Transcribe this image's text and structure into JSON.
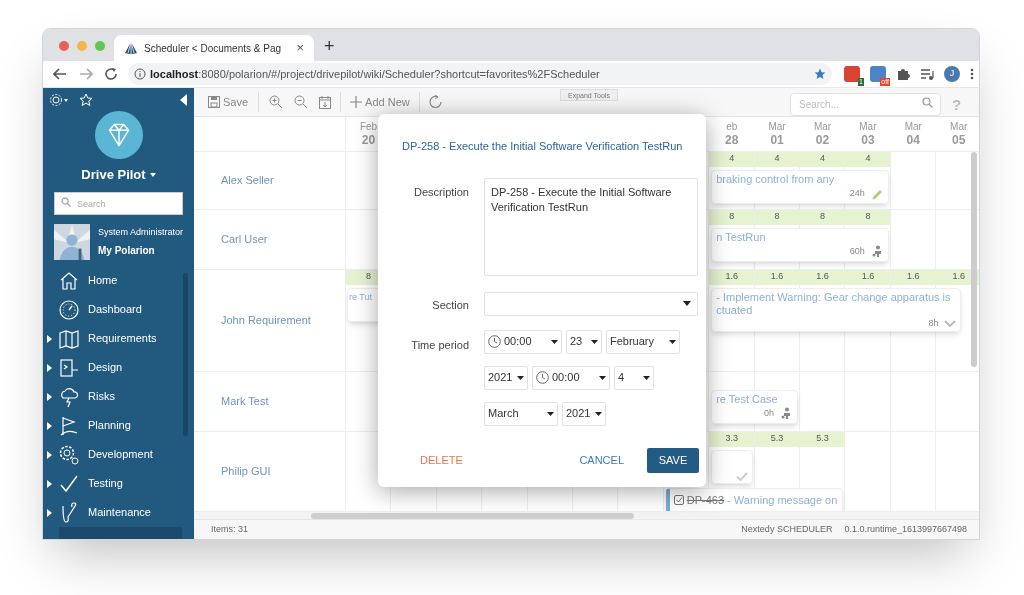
{
  "browser": {
    "tab": {
      "title": "Scheduler < Documents & Pag",
      "close": "×"
    },
    "new_tab": "+",
    "url": {
      "host": "localhost",
      "path": ":8080/polarion/#/project/drivepilot/wiki/Scheduler?shortcut=favorites%2FScheduler"
    },
    "extensions": [
      {
        "badge": "1",
        "color": "#d9432f"
      },
      {
        "badge": "off",
        "color": "#4a86c5"
      }
    ],
    "profile": "J"
  },
  "sidebar": {
    "project": "Drive Pilot",
    "search": {
      "placeholder": "Search"
    },
    "user": {
      "role": "System Administrator",
      "link": "My Polarion"
    },
    "items": [
      {
        "label": "Home",
        "expandable": false
      },
      {
        "label": "Dashboard",
        "expandable": false
      },
      {
        "label": "Requirements",
        "expandable": true
      },
      {
        "label": "Design",
        "expandable": true
      },
      {
        "label": "Risks",
        "expandable": true
      },
      {
        "label": "Planning",
        "expandable": true
      },
      {
        "label": "Development",
        "expandable": true
      },
      {
        "label": "Testing",
        "expandable": true
      },
      {
        "label": "Maintenance",
        "expandable": true
      }
    ]
  },
  "toolbar": {
    "save": "Save",
    "add_new": "Add New",
    "expand_tools": "Expand Tools",
    "search": {
      "placeholder": "Search..."
    },
    "help": "?"
  },
  "timeline": {
    "days": [
      {
        "month": "Feb",
        "day": "20"
      },
      {
        "month": "eb",
        "day": "28"
      },
      {
        "month": "Mar",
        "day": "01"
      },
      {
        "month": "Mar",
        "day": "02"
      },
      {
        "month": "Mar",
        "day": "03"
      },
      {
        "month": "Mar",
        "day": "04"
      },
      {
        "month": "Mar",
        "day": "05"
      }
    ],
    "rows": [
      {
        "name": "Alex Seller",
        "loads": [
          "4",
          "4",
          "4",
          "4"
        ],
        "cards": [
          {
            "kind": "editable",
            "text": "braking control from any",
            "hours": "24h"
          }
        ]
      },
      {
        "name": "Carl User",
        "loads": [
          "8",
          "8",
          "8",
          "8"
        ],
        "cards": [
          {
            "kind": "assigned",
            "text": "n TestRun",
            "hours": "60h"
          }
        ]
      },
      {
        "name": "John Requirement",
        "loads": [
          "8",
          "1.6",
          "1.6",
          "1.6",
          "1.6",
          "1.6",
          "1.6"
        ],
        "cards": [
          {
            "kind": "plain",
            "text": "re Tut"
          },
          {
            "kind": "expandable",
            "text": "- Implement Warning: Gear change apparatus is ctuated",
            "hours": "8h"
          }
        ]
      },
      {
        "name": "Mark Test",
        "cards": [
          {
            "kind": "assigned",
            "text": "re Test Case",
            "hours": "0h"
          }
        ]
      },
      {
        "name": "Philip GUI",
        "loads": [
          "3.3",
          "5.3",
          "5.3"
        ],
        "cards": [
          {
            "kind": "done"
          },
          {
            "kind": "item",
            "id": "DP-463",
            "resolved": true,
            "text": " - Warning message on"
          }
        ]
      }
    ]
  },
  "dialog": {
    "title": "DP-258 - Execute the Initial Software Verification TestRun",
    "description": {
      "label": "Description",
      "value": "DP-258 - Execute the Initial Software Verification TestRun"
    },
    "section": {
      "label": "Section"
    },
    "time_period": {
      "label": "Time period",
      "fields": [
        {
          "kind": "time",
          "value": "00:00"
        },
        {
          "kind": "day",
          "value": "23"
        },
        {
          "kind": "month",
          "value": "February"
        },
        {
          "kind": "year",
          "value": "2021"
        },
        {
          "kind": "time",
          "value": "00:00"
        },
        {
          "kind": "day",
          "value": "4"
        },
        {
          "kind": "month",
          "value": "March"
        },
        {
          "kind": "year",
          "value": "2021"
        }
      ]
    },
    "buttons": {
      "delete": "DELETE",
      "cancel": "CANCEL",
      "save": "SAVE"
    }
  },
  "status_bar": {
    "items": "Items: 31",
    "product": "Nextedy SCHEDULER",
    "version": "0.1.0.runtime_1613997667498"
  }
}
